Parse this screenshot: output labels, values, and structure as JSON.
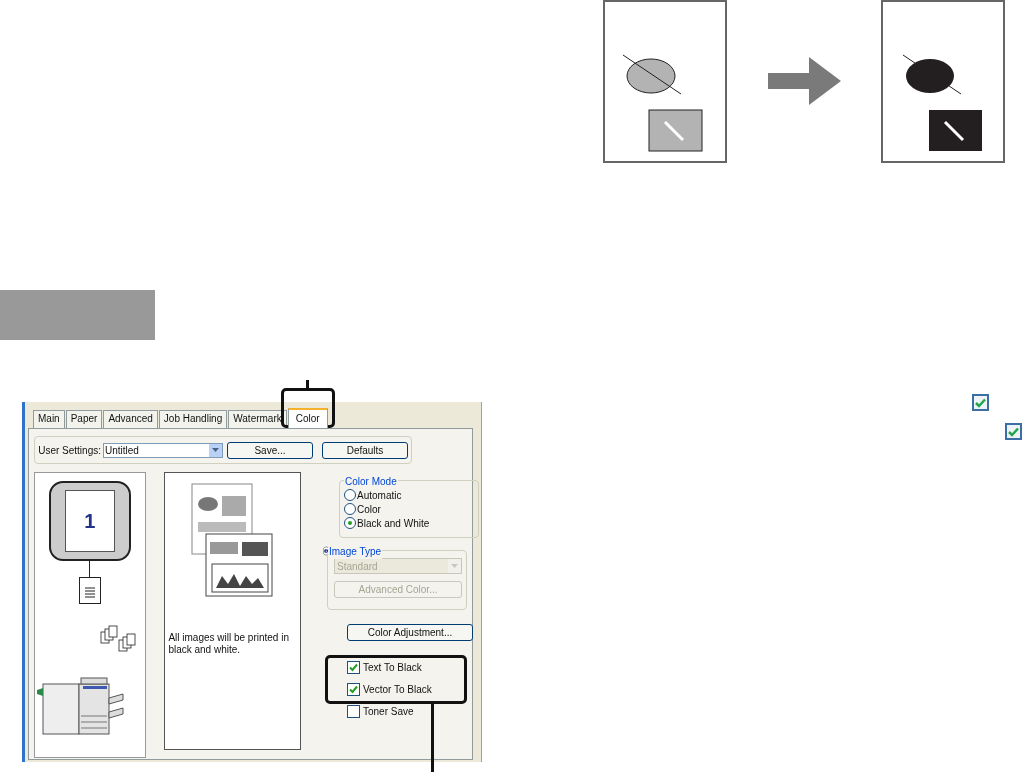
{
  "dialog": {
    "tabs": [
      {
        "label": "Main",
        "selected": false
      },
      {
        "label": "Paper",
        "selected": false
      },
      {
        "label": "Advanced",
        "selected": false
      },
      {
        "label": "Job Handling",
        "selected": false
      },
      {
        "label": "Watermark",
        "selected": false
      },
      {
        "label": "Color",
        "selected": true
      }
    ],
    "user_settings": {
      "label": "User Settings:",
      "value": "Untitled",
      "buttons": [
        "Save...",
        "Defaults"
      ]
    },
    "layout_preview": {
      "page_number": "1"
    },
    "preview_caption": "All images will be printed in black and white.",
    "color_mode": {
      "title": "Color Mode",
      "options": [
        {
          "label": "Automatic",
          "selected": false
        },
        {
          "label": "Color",
          "selected": false
        },
        {
          "label": "Black and White",
          "selected": true
        }
      ]
    },
    "image_type": {
      "title": "Image Type",
      "disabled": true,
      "value": "Standard",
      "button": "Advanced Color..."
    },
    "color_adjustment_button": "Color Adjustment...",
    "checkboxes": [
      {
        "label": "Text To Black",
        "checked": true
      },
      {
        "label": "Vector To Black",
        "checked": true
      },
      {
        "label": "Toner Save",
        "checked": false
      }
    ]
  },
  "margin_checkmarks": [
    {
      "checked": true
    },
    {
      "checked": true
    }
  ]
}
